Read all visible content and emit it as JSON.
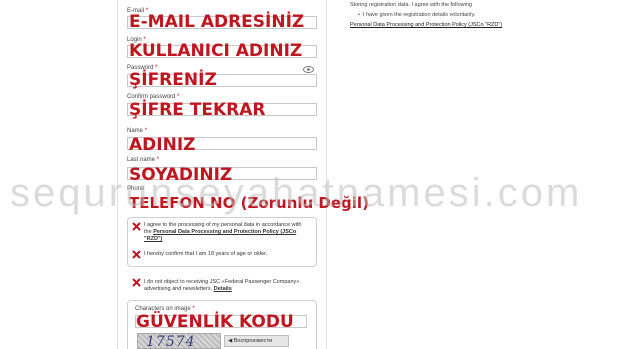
{
  "form": {
    "email_label": "E-mail",
    "email_value": "E-MAIL ADRESİNİZ",
    "login_label": "Login",
    "login_value": "KULLANICI ADINIZ",
    "password_label": "Password",
    "password_value": "ŞİFRENİZ",
    "confirm_label": "Confirm password",
    "confirm_value": "ŞİFRE TEKRAR",
    "name_label": "Name",
    "name_value": "ADINIZ",
    "lastname_label": "Last name",
    "lastname_value": "SOYADINIZ",
    "phone_label": "Phone",
    "phone_value": "TELEFON NO (Zorunlu Değil)",
    "required_mark": "*"
  },
  "consent": {
    "agree_text": "I agree to the processing of my personal data in accordance with the",
    "agree_link": "Personal Data Processing and Protection Policy (JSCo \"RZD\")",
    "age_text": "I hereby confirm that I am 18 years of age or older.",
    "ads_text": "I do not object to receiving JSC «Federal Passenger Company» advertising and newsletters.",
    "ads_details": "Details"
  },
  "captcha": {
    "label": "Characters on image",
    "value": "GÜVENLİK KODU",
    "image_text": "17574",
    "play_label": "Воспроизвести"
  },
  "right": {
    "line1": "Storing registration data. I agree with the following",
    "line2": "I have given the registration details voluntarily.",
    "link": "Personal Data Processing and Protection Policy (JSCo \"RZD\")"
  },
  "watermark": "sequrunseyahatnamesi.com",
  "colors": {
    "overlay": "#c0161f",
    "check_mark": "#c0161f"
  },
  "icons": {
    "password_toggle": "eye-icon",
    "checkbox_mark": "x-mark-icon"
  }
}
